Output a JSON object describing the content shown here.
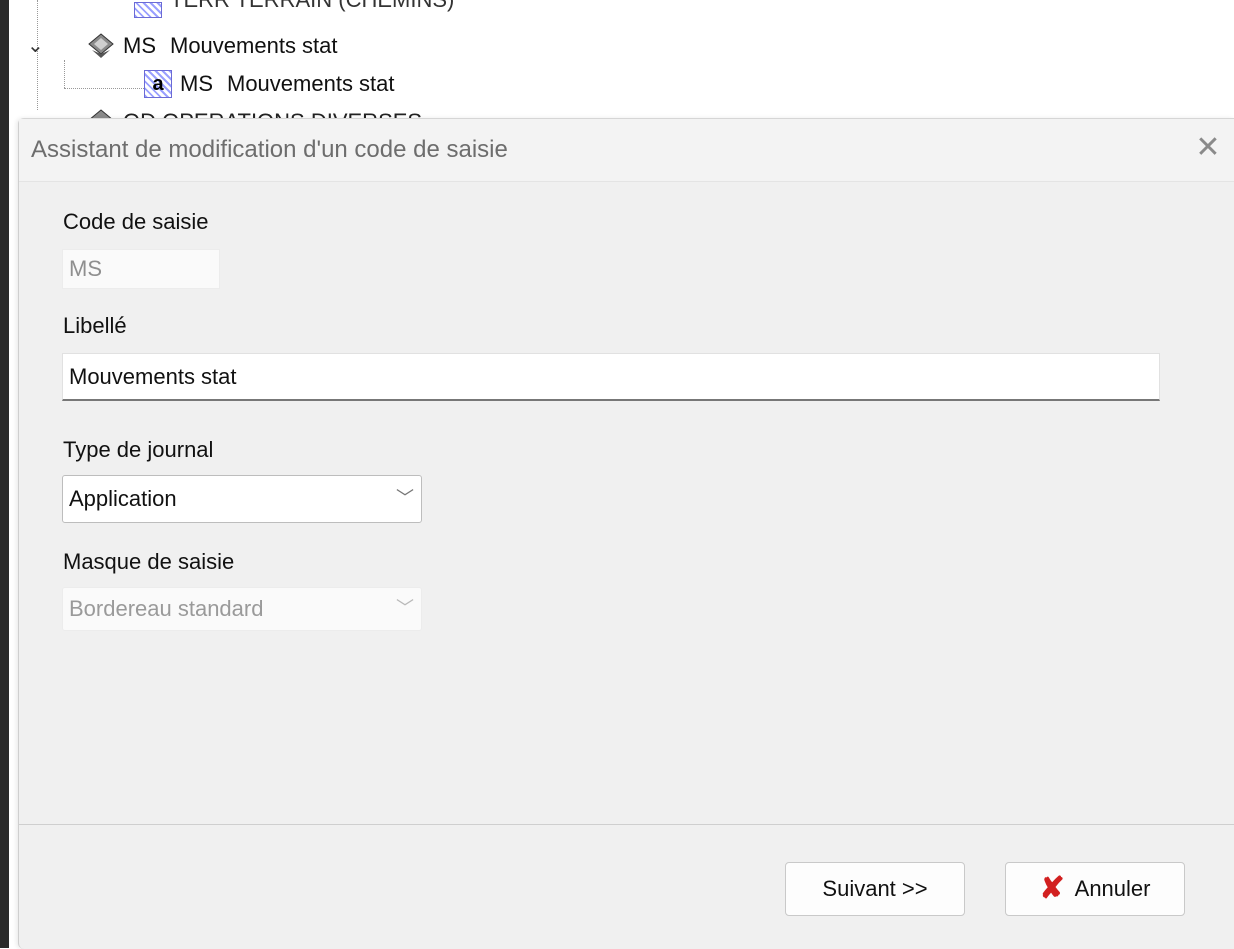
{
  "tree": {
    "partial_top_label": "TERR   TERRAIN (CHEMINS)",
    "items": [
      {
        "code": "MS",
        "label": "Mouvements stat"
      },
      {
        "code": "MS",
        "label": "Mouvements stat"
      }
    ],
    "partial_bottom_label": "OD   OPERATIONS DIVERSES"
  },
  "dialog": {
    "title": "Assistant de modification d'un code de saisie",
    "close_label": "✕",
    "fields": {
      "code_label": "Code de saisie",
      "code_value": "MS",
      "libelle_label": "Libellé",
      "libelle_value": "Mouvements stat",
      "type_label": "Type de journal",
      "type_value": "Application",
      "masque_label": "Masque de saisie",
      "masque_value": "Bordereau standard"
    },
    "buttons": {
      "next_label": "Suivant >>",
      "cancel_label": "Annuler"
    }
  },
  "colors": {
    "dialog_bg": "#f0f0f0",
    "cancel_icon": "#d22020"
  }
}
